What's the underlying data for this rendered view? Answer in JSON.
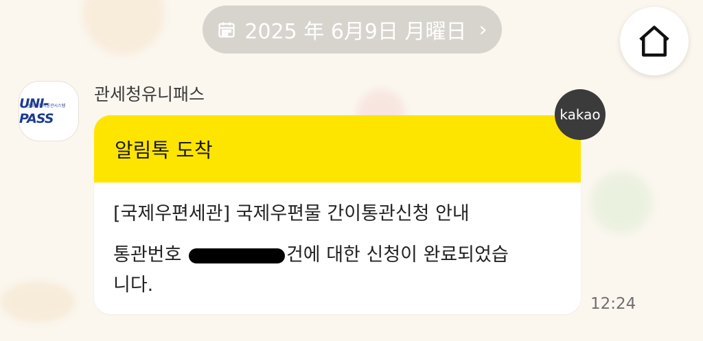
{
  "date_header": {
    "text": "2025 年 6月9日 月曜日",
    "icon": "calendar-icon",
    "chevron": "›"
  },
  "home_button": {
    "icon": "home-icon"
  },
  "sender": {
    "name": "관세청유니패스",
    "avatar_logo_text": "UNI-PASS",
    "avatar_logo_caption": "관세청 전자통관시스템"
  },
  "badge": {
    "label": "kakao"
  },
  "message": {
    "header": "알림톡 도착",
    "line1": "[국제우편세관] 국제우편물 간이통관신청 안내",
    "line2_prefix": "통관번호 ",
    "line2_suffix": "건에 대한 신청이 완료되었습",
    "line3": "니다.",
    "time": "12:24"
  },
  "colors": {
    "accent_yellow": "#fee500",
    "badge_bg": "#3b3b3b",
    "pill_bg": "#d7d4ce"
  }
}
